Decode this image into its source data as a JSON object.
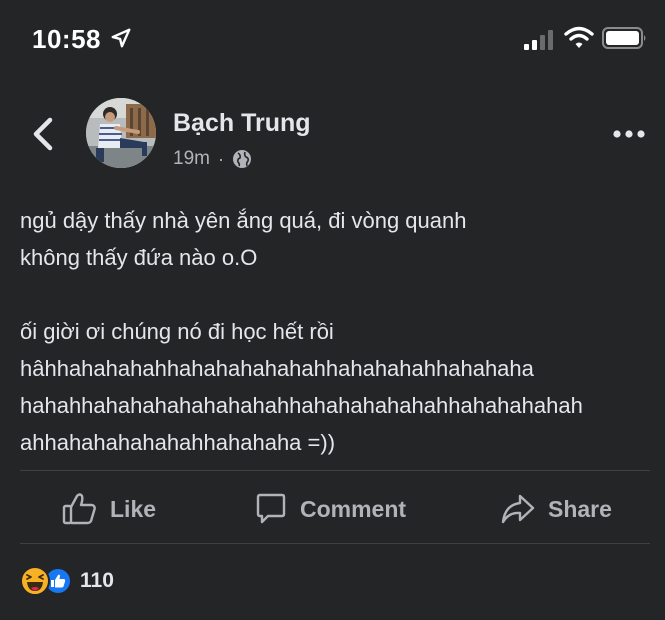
{
  "status_bar": {
    "time": "10:58",
    "icons": [
      "location-arrow-icon",
      "signal-icon",
      "wifi-icon",
      "battery-icon"
    ]
  },
  "header": {
    "back_icon": "chevron-left-icon",
    "author_name": "Bạch Trung",
    "time_ago": "19m",
    "separator": "·",
    "privacy_icon": "globe-icon",
    "more_icon": "more-horizontal-icon"
  },
  "post": {
    "text": "ngủ dậy thấy nhà yên ắng quá, đi vòng quanh\nkhông thấy đứa nào o.O\n\nối giời ơi chúng nó đi học hết rồi\nhâhhahahahahhahahahahahahhahahahahhahahaha\nhahahhahahahahahahahahhahahahahahahhahahahahah\nahhahahahahahahhahahaha =))"
  },
  "actions": {
    "like_label": "Like",
    "comment_label": "Comment",
    "share_label": "Share"
  },
  "reactions": {
    "types": [
      "haha",
      "like"
    ],
    "count": "110"
  },
  "colors": {
    "background": "#242526",
    "text_primary": "#e4e6eb",
    "text_secondary": "#b0b3b8",
    "divider": "#3e4042",
    "like_blue": "#1877f2",
    "haha_yellow": "#f7b125"
  }
}
